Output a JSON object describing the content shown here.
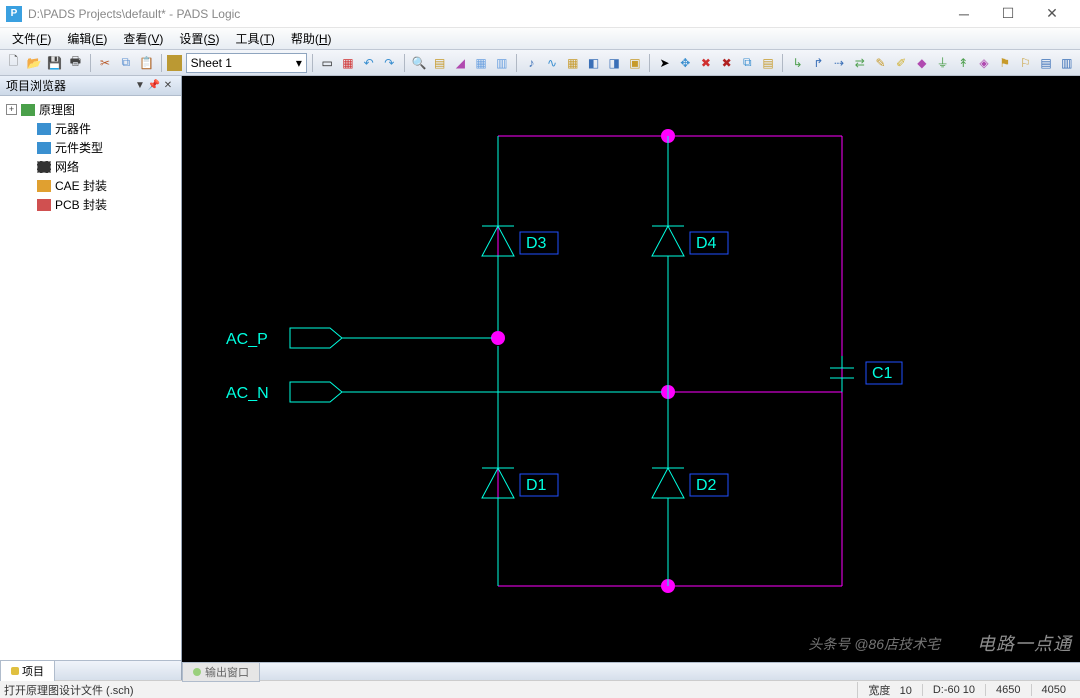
{
  "window": {
    "title": "D:\\PADS Projects\\default* - PADS Logic"
  },
  "menu": {
    "file": {
      "label": "文件",
      "accel": "F"
    },
    "edit": {
      "label": "编辑",
      "accel": "E"
    },
    "view": {
      "label": "查看",
      "accel": "V"
    },
    "setup": {
      "label": "设置",
      "accel": "S"
    },
    "tools": {
      "label": "工具",
      "accel": "T"
    },
    "help": {
      "label": "帮助",
      "accel": "H"
    }
  },
  "toolbar": {
    "sheet_selected": "Sheet 1"
  },
  "sidebar": {
    "title": "项目浏览器",
    "items": [
      {
        "label": "原理图",
        "expandable": true
      },
      {
        "label": "元器件"
      },
      {
        "label": "元件类型"
      },
      {
        "label": "网络"
      },
      {
        "label": "CAE 封装"
      },
      {
        "label": "PCB 封装"
      }
    ],
    "tab_label": "项目"
  },
  "schematic": {
    "nets": {
      "ac_p": "AC_P",
      "ac_n": "AC_N"
    },
    "parts": {
      "d1": "D1",
      "d2": "D2",
      "d3": "D3",
      "d4": "D4",
      "c1": "C1"
    }
  },
  "bottom": {
    "output_tab": "输出窗口"
  },
  "status": {
    "message": "打开原理图设计文件 (.sch)",
    "width_label": "宽度",
    "width_value": "10",
    "d_label": "D:",
    "d_value": "-60 10",
    "x": "4650",
    "y": "4050"
  },
  "watermark": {
    "line1": "电路一点通",
    "line2": "头条号 @86店技术宅"
  }
}
